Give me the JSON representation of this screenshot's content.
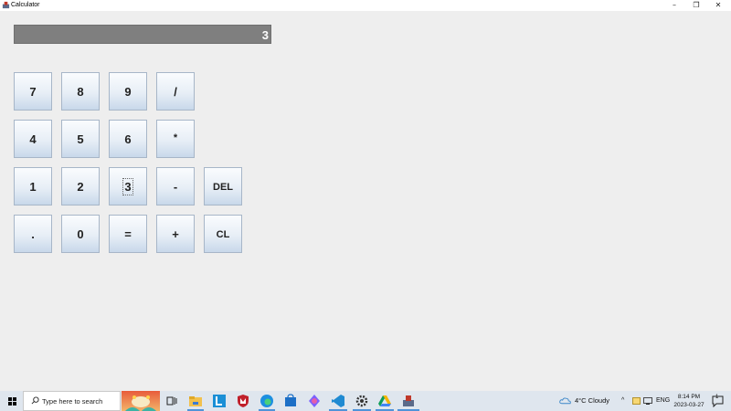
{
  "window": {
    "title": "Calculator",
    "controls": {
      "minimize": "–",
      "maximize": "❐",
      "close": "✕"
    }
  },
  "display": {
    "value": "3"
  },
  "keypad": {
    "rows": [
      [
        "7",
        "8",
        "9",
        "/"
      ],
      [
        "4",
        "5",
        "6",
        "*"
      ],
      [
        "1",
        "2",
        "3",
        "-",
        "DEL"
      ],
      [
        ".",
        "0",
        "=",
        "+",
        "CL"
      ]
    ],
    "focused_key": "3"
  },
  "taskbar": {
    "search_placeholder": "Type here to search",
    "weather": "4°C  Cloudy",
    "tray_chevron": "^",
    "language": "ENG",
    "time": "8:14 PM",
    "date": "2023-03-27",
    "notification_count": "1"
  },
  "colors": {
    "window_bg": "#eeeeee",
    "display_bg": "#7f7f7f",
    "display_text": "#ffffff",
    "key_border": "#a7b6c8",
    "taskbar_bg": "#dfe6ee",
    "active_underline": "#4f93d9"
  }
}
